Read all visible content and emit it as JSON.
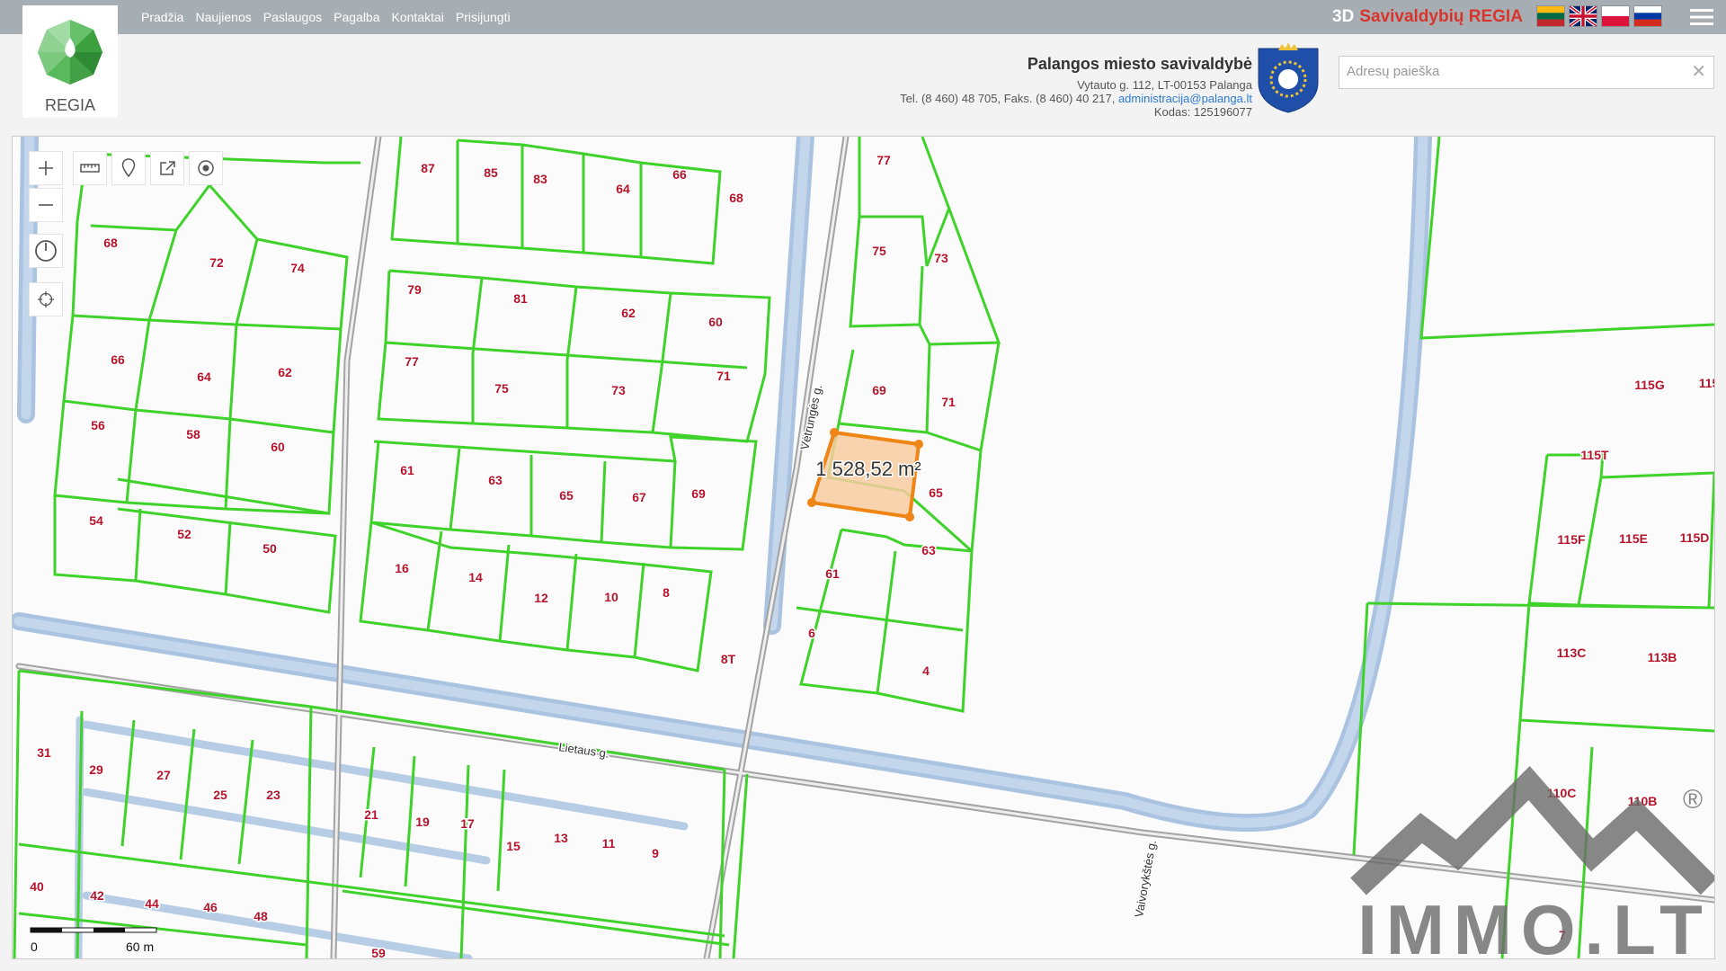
{
  "nav": [
    "Pradžia",
    "Naujienos",
    "Paslaugos",
    "Pagalba",
    "Kontaktai",
    "Prisijungti"
  ],
  "brand": {
    "prefix": "3D",
    "name": "Savivaldybių REGIA"
  },
  "logo": {
    "text": "REGIA"
  },
  "languages": [
    "lt",
    "en",
    "pl",
    "ru"
  ],
  "municipality": {
    "name": "Palangos miesto savivaldybė",
    "address": "Vytauto g. 112, LT-00153 Palanga",
    "phone": "Tel. (8 460) 48 705, Faks. (8 460) 40 217,",
    "email": "administracija@palanga.lt",
    "code": "Kodas: 125196077"
  },
  "search": {
    "placeholder": "Adresų paieška",
    "value": ""
  },
  "map": {
    "selected_parcel_area": "1 528,52 m²",
    "scale": {
      "start": "0",
      "end": "60 m"
    },
    "streets": [
      "Vėtrungės g.",
      "Lietaus g.",
      "Vaivorykštės g."
    ],
    "parcel_labels": [
      "87",
      "85",
      "83",
      "64",
      "66",
      "68",
      "77",
      "68",
      "72",
      "74",
      "75",
      "73",
      "79",
      "81",
      "62",
      "60",
      "66",
      "64",
      "62",
      "77",
      "75",
      "73",
      "71",
      "69",
      "71",
      "56",
      "58",
      "60",
      "61",
      "63",
      "65",
      "67",
      "69",
      "65",
      "54",
      "52",
      "50",
      "16",
      "14",
      "12",
      "10",
      "8",
      "61",
      "63",
      "6",
      "8T",
      "4",
      "31",
      "29",
      "27",
      "25",
      "23",
      "21",
      "19",
      "17",
      "15",
      "13",
      "11",
      "9",
      "40",
      "42",
      "44",
      "46",
      "48",
      "59",
      "115G",
      "115",
      "115T",
      "115F",
      "115E",
      "115D",
      "113C",
      "113B",
      "110C",
      "110B",
      "7"
    ],
    "watermark": "IMMO.LT",
    "watermark_mark": "®"
  },
  "colors": {
    "parcel": "#3fd22a",
    "label": "#b5142b",
    "selected_fill": "#f8cba0",
    "selected_stroke": "#ef8514",
    "road": "#a9c3e0",
    "topbar": "#a6adb3",
    "brand": "#d9342b"
  }
}
